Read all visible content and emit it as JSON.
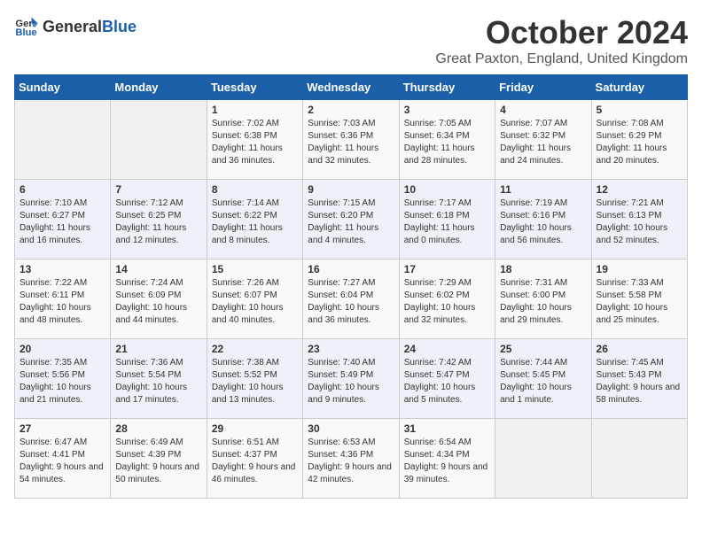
{
  "header": {
    "logo_general": "General",
    "logo_blue": "Blue",
    "month": "October 2024",
    "location": "Great Paxton, England, United Kingdom"
  },
  "days_of_week": [
    "Sunday",
    "Monday",
    "Tuesday",
    "Wednesday",
    "Thursday",
    "Friday",
    "Saturday"
  ],
  "weeks": [
    [
      {
        "day": "",
        "sunrise": "",
        "sunset": "",
        "daylight": ""
      },
      {
        "day": "",
        "sunrise": "",
        "sunset": "",
        "daylight": ""
      },
      {
        "day": "1",
        "sunrise": "Sunrise: 7:02 AM",
        "sunset": "Sunset: 6:38 PM",
        "daylight": "Daylight: 11 hours and 36 minutes."
      },
      {
        "day": "2",
        "sunrise": "Sunrise: 7:03 AM",
        "sunset": "Sunset: 6:36 PM",
        "daylight": "Daylight: 11 hours and 32 minutes."
      },
      {
        "day": "3",
        "sunrise": "Sunrise: 7:05 AM",
        "sunset": "Sunset: 6:34 PM",
        "daylight": "Daylight: 11 hours and 28 minutes."
      },
      {
        "day": "4",
        "sunrise": "Sunrise: 7:07 AM",
        "sunset": "Sunset: 6:32 PM",
        "daylight": "Daylight: 11 hours and 24 minutes."
      },
      {
        "day": "5",
        "sunrise": "Sunrise: 7:08 AM",
        "sunset": "Sunset: 6:29 PM",
        "daylight": "Daylight: 11 hours and 20 minutes."
      }
    ],
    [
      {
        "day": "6",
        "sunrise": "Sunrise: 7:10 AM",
        "sunset": "Sunset: 6:27 PM",
        "daylight": "Daylight: 11 hours and 16 minutes."
      },
      {
        "day": "7",
        "sunrise": "Sunrise: 7:12 AM",
        "sunset": "Sunset: 6:25 PM",
        "daylight": "Daylight: 11 hours and 12 minutes."
      },
      {
        "day": "8",
        "sunrise": "Sunrise: 7:14 AM",
        "sunset": "Sunset: 6:22 PM",
        "daylight": "Daylight: 11 hours and 8 minutes."
      },
      {
        "day": "9",
        "sunrise": "Sunrise: 7:15 AM",
        "sunset": "Sunset: 6:20 PM",
        "daylight": "Daylight: 11 hours and 4 minutes."
      },
      {
        "day": "10",
        "sunrise": "Sunrise: 7:17 AM",
        "sunset": "Sunset: 6:18 PM",
        "daylight": "Daylight: 11 hours and 0 minutes."
      },
      {
        "day": "11",
        "sunrise": "Sunrise: 7:19 AM",
        "sunset": "Sunset: 6:16 PM",
        "daylight": "Daylight: 10 hours and 56 minutes."
      },
      {
        "day": "12",
        "sunrise": "Sunrise: 7:21 AM",
        "sunset": "Sunset: 6:13 PM",
        "daylight": "Daylight: 10 hours and 52 minutes."
      }
    ],
    [
      {
        "day": "13",
        "sunrise": "Sunrise: 7:22 AM",
        "sunset": "Sunset: 6:11 PM",
        "daylight": "Daylight: 10 hours and 48 minutes."
      },
      {
        "day": "14",
        "sunrise": "Sunrise: 7:24 AM",
        "sunset": "Sunset: 6:09 PM",
        "daylight": "Daylight: 10 hours and 44 minutes."
      },
      {
        "day": "15",
        "sunrise": "Sunrise: 7:26 AM",
        "sunset": "Sunset: 6:07 PM",
        "daylight": "Daylight: 10 hours and 40 minutes."
      },
      {
        "day": "16",
        "sunrise": "Sunrise: 7:27 AM",
        "sunset": "Sunset: 6:04 PM",
        "daylight": "Daylight: 10 hours and 36 minutes."
      },
      {
        "day": "17",
        "sunrise": "Sunrise: 7:29 AM",
        "sunset": "Sunset: 6:02 PM",
        "daylight": "Daylight: 10 hours and 32 minutes."
      },
      {
        "day": "18",
        "sunrise": "Sunrise: 7:31 AM",
        "sunset": "Sunset: 6:00 PM",
        "daylight": "Daylight: 10 hours and 29 minutes."
      },
      {
        "day": "19",
        "sunrise": "Sunrise: 7:33 AM",
        "sunset": "Sunset: 5:58 PM",
        "daylight": "Daylight: 10 hours and 25 minutes."
      }
    ],
    [
      {
        "day": "20",
        "sunrise": "Sunrise: 7:35 AM",
        "sunset": "Sunset: 5:56 PM",
        "daylight": "Daylight: 10 hours and 21 minutes."
      },
      {
        "day": "21",
        "sunrise": "Sunrise: 7:36 AM",
        "sunset": "Sunset: 5:54 PM",
        "daylight": "Daylight: 10 hours and 17 minutes."
      },
      {
        "day": "22",
        "sunrise": "Sunrise: 7:38 AM",
        "sunset": "Sunset: 5:52 PM",
        "daylight": "Daylight: 10 hours and 13 minutes."
      },
      {
        "day": "23",
        "sunrise": "Sunrise: 7:40 AM",
        "sunset": "Sunset: 5:49 PM",
        "daylight": "Daylight: 10 hours and 9 minutes."
      },
      {
        "day": "24",
        "sunrise": "Sunrise: 7:42 AM",
        "sunset": "Sunset: 5:47 PM",
        "daylight": "Daylight: 10 hours and 5 minutes."
      },
      {
        "day": "25",
        "sunrise": "Sunrise: 7:44 AM",
        "sunset": "Sunset: 5:45 PM",
        "daylight": "Daylight: 10 hours and 1 minute."
      },
      {
        "day": "26",
        "sunrise": "Sunrise: 7:45 AM",
        "sunset": "Sunset: 5:43 PM",
        "daylight": "Daylight: 9 hours and 58 minutes."
      }
    ],
    [
      {
        "day": "27",
        "sunrise": "Sunrise: 6:47 AM",
        "sunset": "Sunset: 4:41 PM",
        "daylight": "Daylight: 9 hours and 54 minutes."
      },
      {
        "day": "28",
        "sunrise": "Sunrise: 6:49 AM",
        "sunset": "Sunset: 4:39 PM",
        "daylight": "Daylight: 9 hours and 50 minutes."
      },
      {
        "day": "29",
        "sunrise": "Sunrise: 6:51 AM",
        "sunset": "Sunset: 4:37 PM",
        "daylight": "Daylight: 9 hours and 46 minutes."
      },
      {
        "day": "30",
        "sunrise": "Sunrise: 6:53 AM",
        "sunset": "Sunset: 4:36 PM",
        "daylight": "Daylight: 9 hours and 42 minutes."
      },
      {
        "day": "31",
        "sunrise": "Sunrise: 6:54 AM",
        "sunset": "Sunset: 4:34 PM",
        "daylight": "Daylight: 9 hours and 39 minutes."
      },
      {
        "day": "",
        "sunrise": "",
        "sunset": "",
        "daylight": ""
      },
      {
        "day": "",
        "sunrise": "",
        "sunset": "",
        "daylight": ""
      }
    ]
  ]
}
